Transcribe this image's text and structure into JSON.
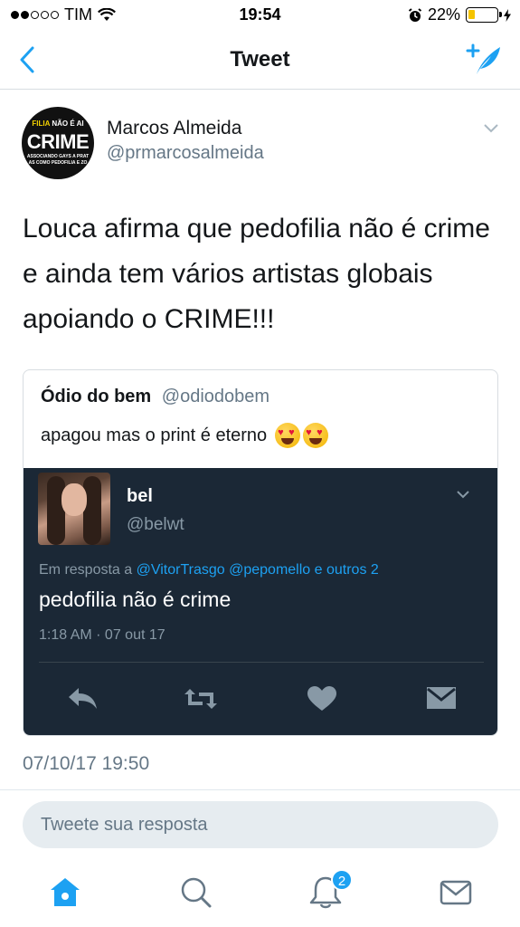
{
  "status_bar": {
    "carrier": "TIM",
    "time": "19:54",
    "battery_percent": "22%",
    "battery_level": 0.22,
    "signal_bars_filled": 2,
    "signal_bars_total": 5
  },
  "nav": {
    "title": "Tweet",
    "back_icon": "chevron-left-icon",
    "compose_icon": "compose-tweet-icon"
  },
  "tweet": {
    "author_name": "Marcos Almeida",
    "author_handle": "@prmarcosalmeida",
    "avatar": {
      "top_text_a": "FILIA",
      "top_text_b": "NÃO É AI",
      "main_text": "CRIME",
      "sub_text_1": "ASSOCIANDO GAYS A PRAT",
      "sub_text_2": "AS COMO PEDOFILIA E ZO"
    },
    "text": "Louca afirma que pedofilia não é crime e ainda tem vários artistas globais apoiando o CRIME!!!",
    "date": "07/10/17 19:50"
  },
  "quote": {
    "name": "Ódio do bem",
    "handle": "@odiodobem",
    "text": "apagou mas o print é eterno",
    "emoji": "heart-eyes-emoji"
  },
  "embedded": {
    "name": "bel",
    "handle": "@belwt",
    "reply_prefix": "Em resposta a",
    "reply_mentions": "@VitorTrasgo @pepomello e outros 2",
    "text": "pedofilia não é crime",
    "time": "1:18 AM · 07 out 17"
  },
  "reply_input": {
    "placeholder": "Tweete sua resposta"
  },
  "tab_bar": {
    "notifications_badge": "2"
  },
  "colors": {
    "accent": "#1da1f2",
    "dark_bg": "#1b2836",
    "muted": "#657786"
  }
}
